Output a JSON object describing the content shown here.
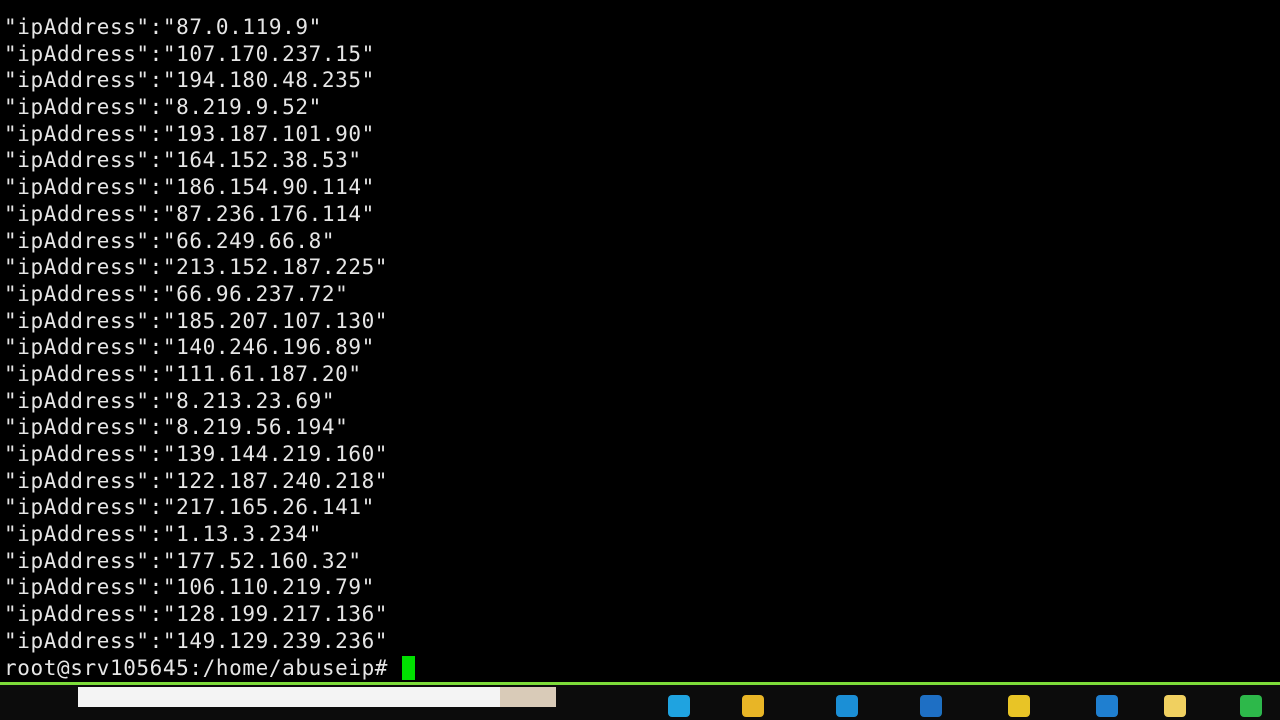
{
  "terminal": {
    "lines": [
      "\"ipAddress\":\"87.0.119.9\"",
      "\"ipAddress\":\"107.170.237.15\"",
      "\"ipAddress\":\"194.180.48.235\"",
      "\"ipAddress\":\"8.219.9.52\"",
      "\"ipAddress\":\"193.187.101.90\"",
      "\"ipAddress\":\"164.152.38.53\"",
      "\"ipAddress\":\"186.154.90.114\"",
      "\"ipAddress\":\"87.236.176.114\"",
      "\"ipAddress\":\"66.249.66.8\"",
      "\"ipAddress\":\"213.152.187.225\"",
      "\"ipAddress\":\"66.96.237.72\"",
      "\"ipAddress\":\"185.207.107.130\"",
      "\"ipAddress\":\"140.246.196.89\"",
      "\"ipAddress\":\"111.61.187.20\"",
      "\"ipAddress\":\"8.213.23.69\"",
      "\"ipAddress\":\"8.219.56.194\"",
      "\"ipAddress\":\"139.144.219.160\"",
      "\"ipAddress\":\"122.187.240.218\"",
      "\"ipAddress\":\"217.165.26.141\"",
      "\"ipAddress\":\"1.13.3.234\"",
      "\"ipAddress\":\"177.52.160.32\"",
      "\"ipAddress\":\"106.110.219.79\"",
      "\"ipAddress\":\"128.199.217.136\"",
      "\"ipAddress\":\"149.129.239.236\""
    ],
    "prompt": "root@srv105645:/home/abuseip#",
    "cursor_color": "#00e000",
    "text_color": "#e6e6e6",
    "background": "#000000"
  },
  "taskbar": {
    "accent_color": "#7ddc3a",
    "icons": [
      {
        "name": "browser-icon",
        "color": "#1fa3e0"
      },
      {
        "name": "folder-icon",
        "color": "#e8b526"
      },
      {
        "name": "app-icon",
        "color": "#1b8fd6"
      },
      {
        "name": "code-editor-icon",
        "color": "#1e6fc4"
      },
      {
        "name": "warning-app-icon",
        "color": "#e8c426"
      },
      {
        "name": "arrow-app-icon",
        "color": "#1f7fd0"
      },
      {
        "name": "notes-icon",
        "color": "#f0d060"
      },
      {
        "name": "terminal-app-icon",
        "color": "#2db84a"
      }
    ]
  }
}
